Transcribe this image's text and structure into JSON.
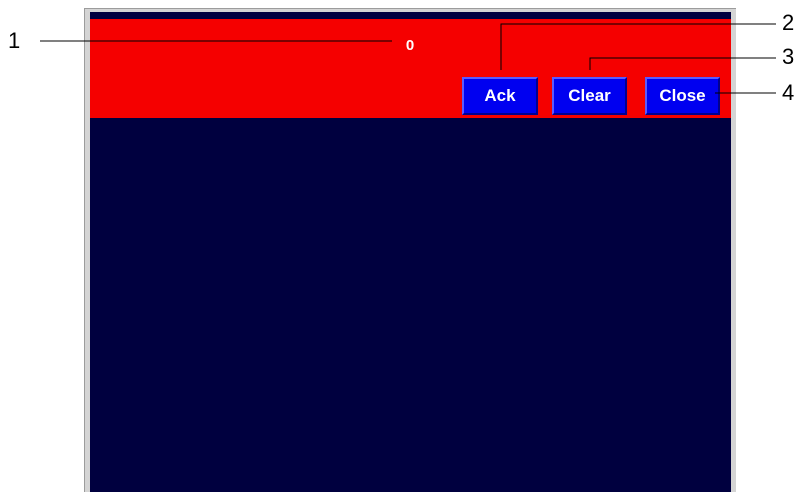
{
  "alarm_banner": {
    "count": "0",
    "background_color": "#f50000"
  },
  "buttons": {
    "ack_label": "Ack",
    "clear_label": "Clear",
    "close_label": "Close",
    "color": "#0000f0"
  },
  "screen": {
    "background_color": "#00003f"
  },
  "callouts": [
    "1",
    "2",
    "3",
    "4"
  ]
}
